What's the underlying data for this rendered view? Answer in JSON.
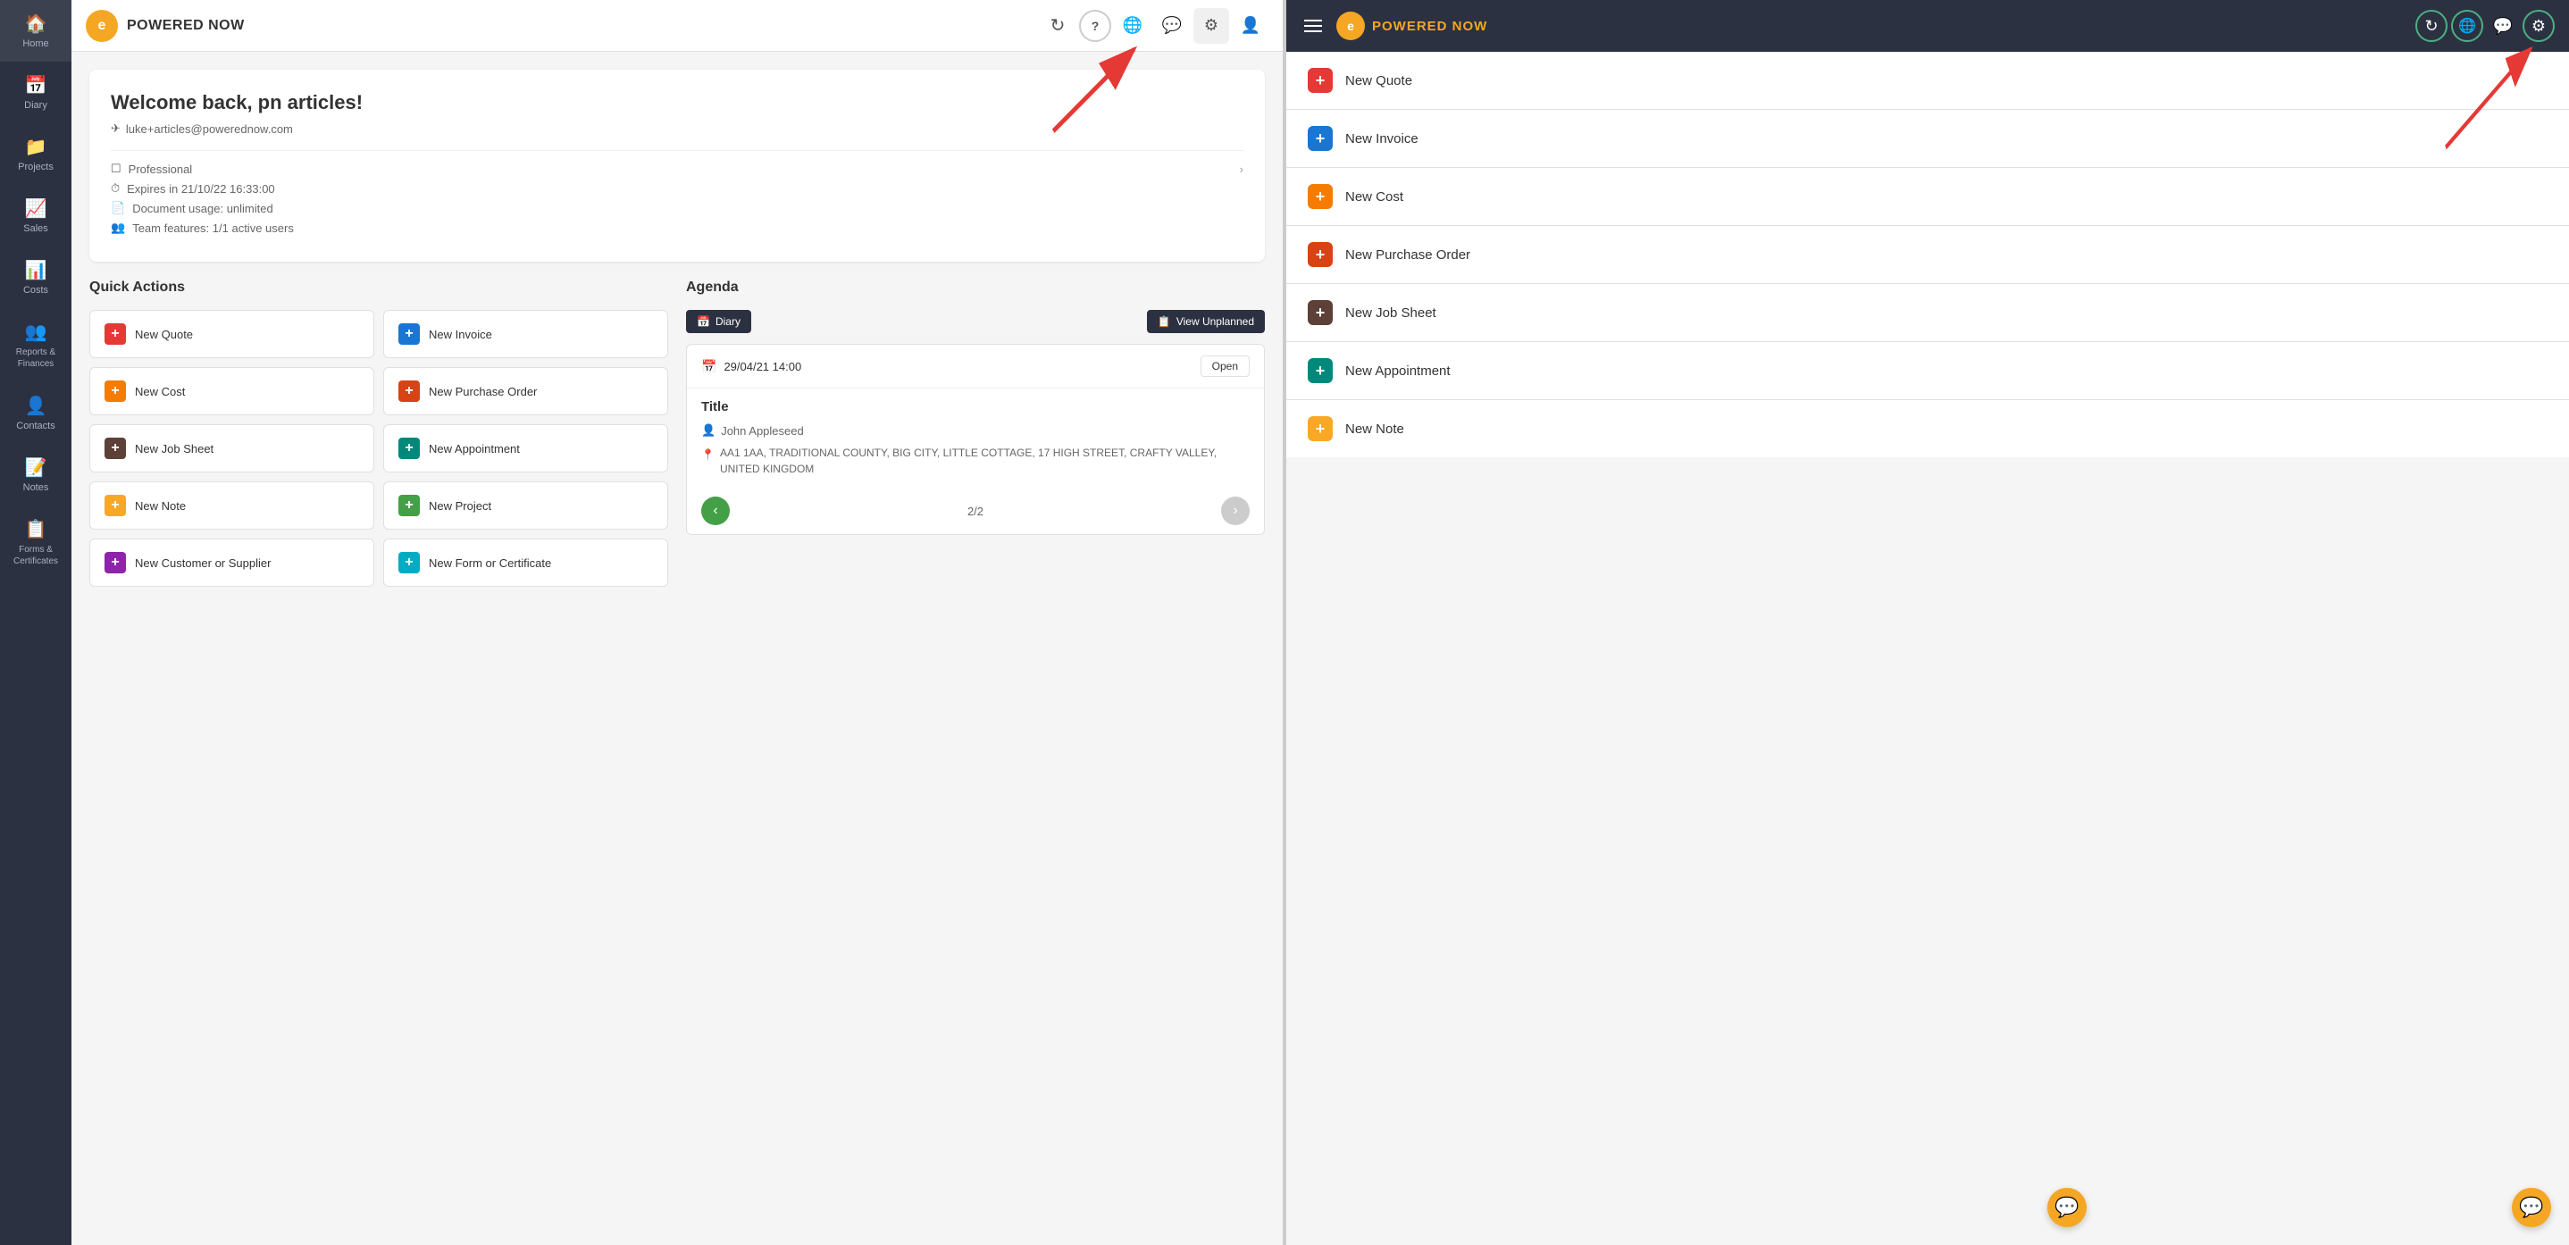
{
  "left": {
    "sidebar": {
      "items": [
        {
          "id": "home",
          "label": "Home",
          "icon": "🏠"
        },
        {
          "id": "diary",
          "label": "Diary",
          "icon": "📅"
        },
        {
          "id": "projects",
          "label": "Projects",
          "icon": "📁"
        },
        {
          "id": "sales",
          "label": "Sales",
          "icon": "📊"
        },
        {
          "id": "costs",
          "label": "Costs",
          "icon": "📊"
        },
        {
          "id": "reports",
          "label": "Reports & Finances",
          "icon": "👥"
        },
        {
          "id": "contacts",
          "label": "Contacts",
          "icon": "👤"
        },
        {
          "id": "notes",
          "label": "Notes",
          "icon": "📝"
        },
        {
          "id": "forms",
          "label": "Forms & Certificates",
          "icon": "📋"
        }
      ]
    },
    "topbar": {
      "logo_letter": "e",
      "logo_text": "POWERED NOW",
      "icons": [
        {
          "id": "sync",
          "symbol": "↻",
          "title": "Sync"
        },
        {
          "id": "help",
          "symbol": "?",
          "title": "Help"
        },
        {
          "id": "globe",
          "symbol": "🌐",
          "title": "Language"
        },
        {
          "id": "chat",
          "symbol": "💬",
          "title": "Chat"
        },
        {
          "id": "settings",
          "symbol": "⚙",
          "title": "Settings"
        },
        {
          "id": "user",
          "symbol": "👤",
          "title": "User"
        }
      ]
    },
    "welcome": {
      "title": "Welcome back, pn articles!",
      "email": "luke+articles@powerednow.com",
      "plan": "Professional",
      "expires": "Expires in 21/10/22 16:33:00",
      "document_usage": "Document usage: unlimited",
      "team_features": "Team features: 1/1 active users"
    },
    "quick_actions": {
      "title": "Quick Actions",
      "buttons": [
        {
          "id": "new-quote",
          "label": "New Quote",
          "color": "red"
        },
        {
          "id": "new-invoice",
          "label": "New Invoice",
          "color": "blue"
        },
        {
          "id": "new-cost",
          "label": "New Cost",
          "color": "orange"
        },
        {
          "id": "new-purchase-order",
          "label": "New Purchase Order",
          "color": "dark-orange"
        },
        {
          "id": "new-job-sheet",
          "label": "New Job Sheet",
          "color": "dark-gray"
        },
        {
          "id": "new-appointment",
          "label": "New Appointment",
          "color": "teal"
        },
        {
          "id": "new-note",
          "label": "New Note",
          "color": "yellow"
        },
        {
          "id": "new-project",
          "label": "New Project",
          "color": "green"
        },
        {
          "id": "new-customer",
          "label": "New Customer or Supplier",
          "color": "purple"
        },
        {
          "id": "new-form",
          "label": "New Form or Certificate",
          "color": "cyan"
        }
      ]
    },
    "agenda": {
      "title": "Agenda",
      "diary_btn": "Diary",
      "view_unplanned_btn": "View Unplanned",
      "event": {
        "date": "29/04/21 14:00",
        "status": "Open",
        "title": "Title",
        "person": "John Appleseed",
        "address": "AA1 1AA, TRADITIONAL COUNTY, BIG CITY, LITTLE COTTAGE, 17 HIGH STREET, CRAFTY VALLEY, UNITED KINGDOM"
      },
      "pagination": "2/2"
    }
  },
  "right": {
    "topbar": {
      "logo_letter": "e",
      "logo_text": "POWERED NOW",
      "icons": [
        {
          "id": "sync",
          "symbol": "↻"
        },
        {
          "id": "globe",
          "symbol": "🌐"
        },
        {
          "id": "chat",
          "symbol": "💬"
        },
        {
          "id": "settings",
          "symbol": "⚙"
        }
      ]
    },
    "items": [
      {
        "id": "new-quote",
        "label": "New Quote",
        "color": "red"
      },
      {
        "id": "new-invoice",
        "label": "New Invoice",
        "color": "blue"
      },
      {
        "id": "new-cost",
        "label": "New Cost",
        "color": "orange"
      },
      {
        "id": "new-purchase-order",
        "label": "New Purchase Order",
        "color": "dark-orange"
      },
      {
        "id": "new-job-sheet",
        "label": "New Job Sheet",
        "color": "dark-gray"
      },
      {
        "id": "new-appointment",
        "label": "New Appointment",
        "color": "teal"
      },
      {
        "id": "new-note",
        "label": "New Note",
        "color": "yellow"
      }
    ]
  }
}
